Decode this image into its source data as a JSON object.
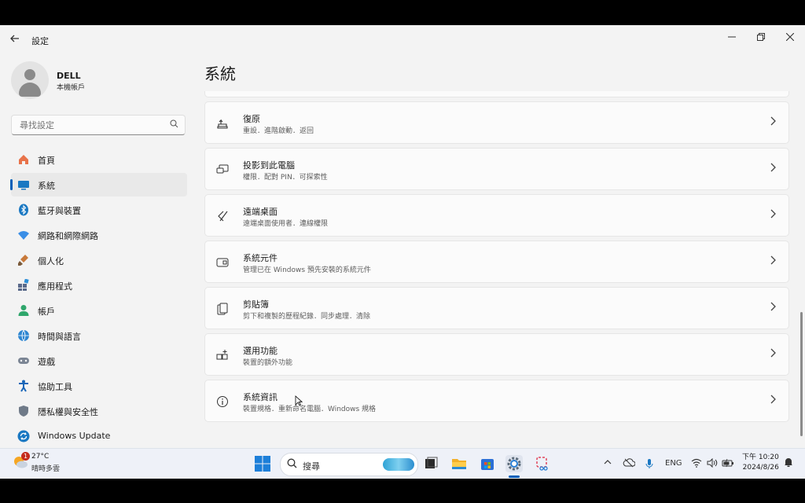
{
  "window": {
    "app_title": "設定",
    "page_title": "系統"
  },
  "user": {
    "name": "DELL",
    "account_type": "本機帳戶"
  },
  "search": {
    "placeholder": "尋找設定"
  },
  "sidebar": {
    "items": [
      {
        "label": "首頁",
        "icon": "home-icon"
      },
      {
        "label": "系統",
        "icon": "system-icon",
        "active": true
      },
      {
        "label": "藍牙與裝置",
        "icon": "bluetooth-icon"
      },
      {
        "label": "網路和網際網路",
        "icon": "network-icon"
      },
      {
        "label": "個人化",
        "icon": "brush-icon"
      },
      {
        "label": "應用程式",
        "icon": "apps-icon"
      },
      {
        "label": "帳戶",
        "icon": "account-icon"
      },
      {
        "label": "時間與語言",
        "icon": "globe-icon"
      },
      {
        "label": "遊戲",
        "icon": "gamepad-icon"
      },
      {
        "label": "協助工具",
        "icon": "accessibility-icon"
      },
      {
        "label": "隱私權與安全性",
        "icon": "shield-icon"
      },
      {
        "label": "Windows Update",
        "icon": "update-icon"
      }
    ]
  },
  "cards": [
    {
      "title": "復原",
      "subtitle": "重設．進階啟動．返回",
      "icon": "recovery-icon"
    },
    {
      "title": "投影到此電腦",
      "subtitle": "權限．配對 PIN．可探索性",
      "icon": "project-icon"
    },
    {
      "title": "遠端桌面",
      "subtitle": "遠端桌面使用者．連線權限",
      "icon": "remote-desktop-icon"
    },
    {
      "title": "系統元件",
      "subtitle": "管理已在 Windows 預先安裝的系統元件",
      "icon": "components-icon"
    },
    {
      "title": "剪貼簿",
      "subtitle": "剪下和複製的歷程紀錄．同步處理．清除",
      "icon": "clipboard-icon"
    },
    {
      "title": "選用功能",
      "subtitle": "裝置的額外功能",
      "icon": "optional-features-icon"
    },
    {
      "title": "系統資訊",
      "subtitle": "裝置規格．重新命名電腦．Windows 規格",
      "icon": "info-icon"
    }
  ],
  "taskbar": {
    "weather_temp": "27°C",
    "weather_condition": "晴時多雲",
    "weather_badge": "1",
    "search_label": "搜尋",
    "language": "ENG",
    "time": "下午 10:20",
    "date": "2024/8/26"
  },
  "colors": {
    "accent": "#005fb8",
    "window_bg": "#f3f3f3",
    "card_bg": "#fbfbfb",
    "taskbar_bg": "#eef1f8"
  }
}
